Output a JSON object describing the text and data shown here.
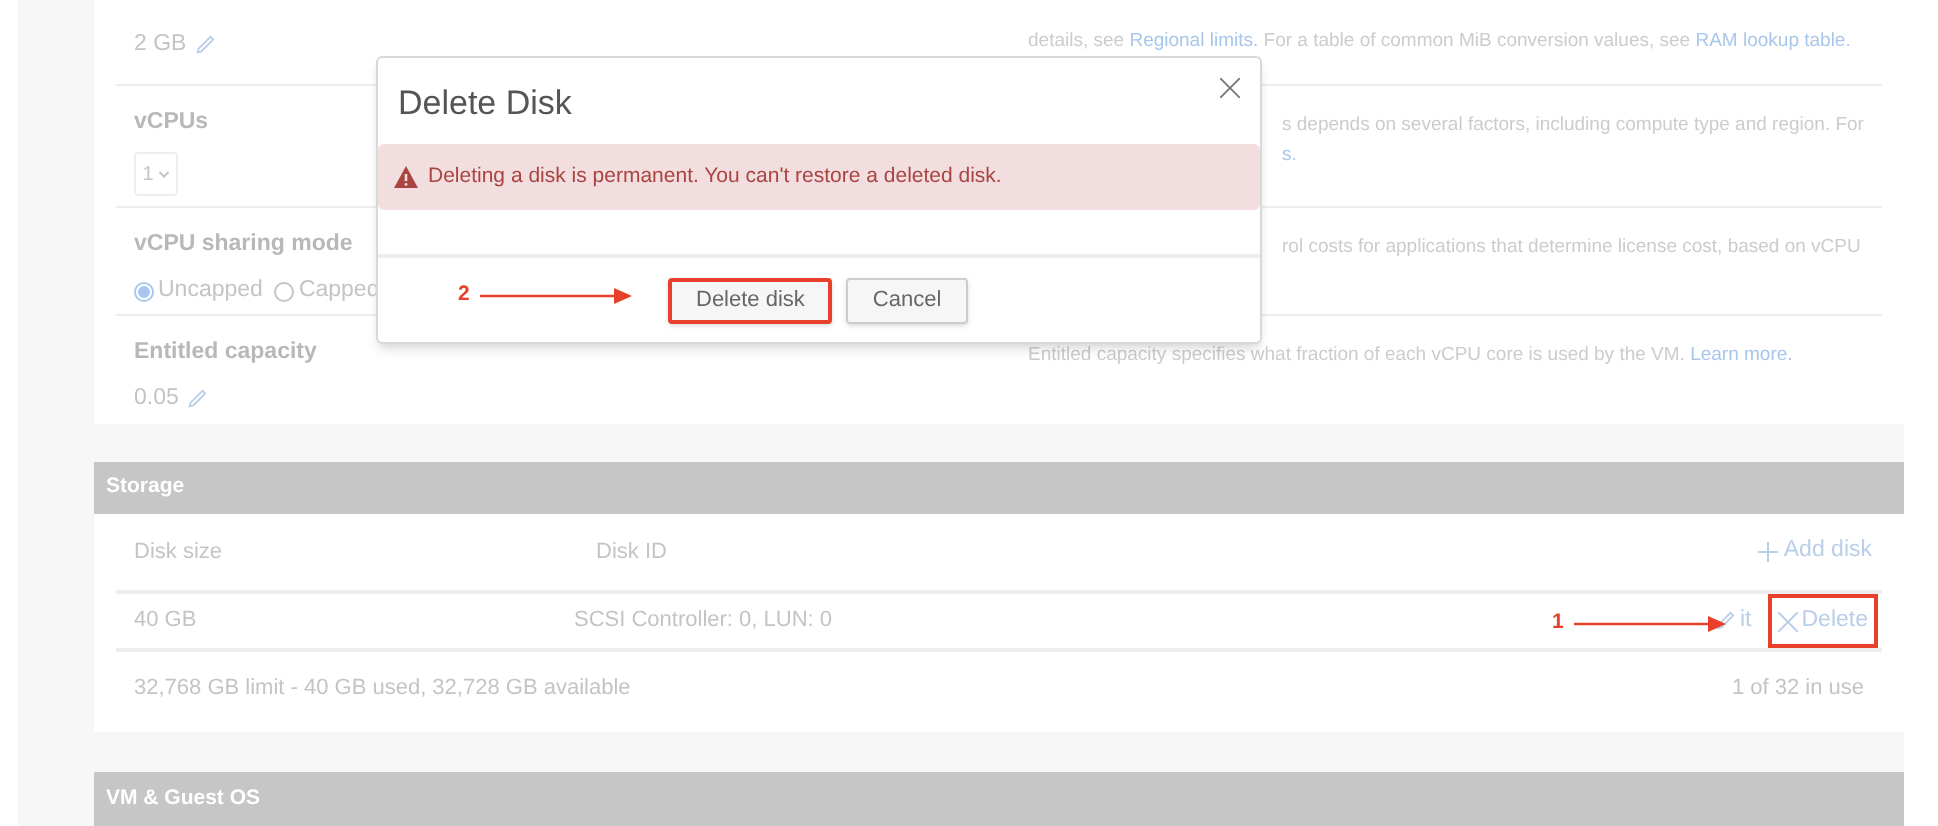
{
  "settings": [
    {
      "kind": "text",
      "value": "2 GB",
      "editable": true,
      "partial": false,
      "description": [
        [
          {
            "kind": "text",
            "text": "details, see "
          },
          {
            "kind": "link",
            "text": "Regional limits."
          },
          {
            "kind": "text",
            "text": " For a table of common MiB conversion values, see "
          },
          {
            "kind": "link",
            "text": "RAM lookup table."
          }
        ]
      ]
    },
    {
      "kind": "select",
      "label": "vCPUs",
      "value": "1",
      "partial": true,
      "description": [
        [
          {
            "kind": "text",
            "text": "s depends on several factors, including compute type and region. For"
          }
        ],
        [
          {
            "kind": "link",
            "text": "s."
          }
        ]
      ]
    },
    {
      "kind": "radio",
      "label": "vCPU sharing mode",
      "options": [
        {
          "label": "Uncapped",
          "selected": true
        },
        {
          "label": "Capped",
          "selected": false
        }
      ],
      "partial": true,
      "description": [
        [
          {
            "kind": "text",
            "text": "rol costs for applications that determine license cost, based on vCPU"
          }
        ]
      ]
    },
    {
      "kind": "text",
      "label": "Entitled capacity",
      "value": "0.05",
      "editable": true,
      "partial": false,
      "description": [
        [
          {
            "kind": "text",
            "text": "Entitled capacity specifies what fraction of each vCPU core is used by the VM. "
          },
          {
            "kind": "link",
            "text": "Learn more."
          }
        ]
      ]
    }
  ],
  "storage": {
    "title": "Storage",
    "columns": [
      "Disk size",
      "Disk ID"
    ],
    "add_button": "Add disk",
    "rows": [
      {
        "size": "40 GB",
        "id": "SCSI Controller: 0, LUN: 0",
        "actions": [
          {
            "kind": "edit",
            "label": "it",
            "highlighted": false
          },
          {
            "kind": "delete",
            "label": "Delete",
            "highlighted": true
          }
        ]
      }
    ],
    "limit": "32,768 GB limit - 40 GB used, 32,728 GB available",
    "usage": "1 of 32 in use"
  },
  "next_section": {
    "title": "VM & Guest OS"
  },
  "dialog": {
    "title": "Delete Disk",
    "warning": "Deleting a disk is permanent. You can't restore a deleted disk.",
    "buttons": [
      {
        "label": "Delete disk",
        "highlighted": true
      },
      {
        "label": "Cancel",
        "highlighted": false
      }
    ]
  },
  "callouts": [
    {
      "number": "1"
    },
    {
      "number": "2"
    }
  ]
}
